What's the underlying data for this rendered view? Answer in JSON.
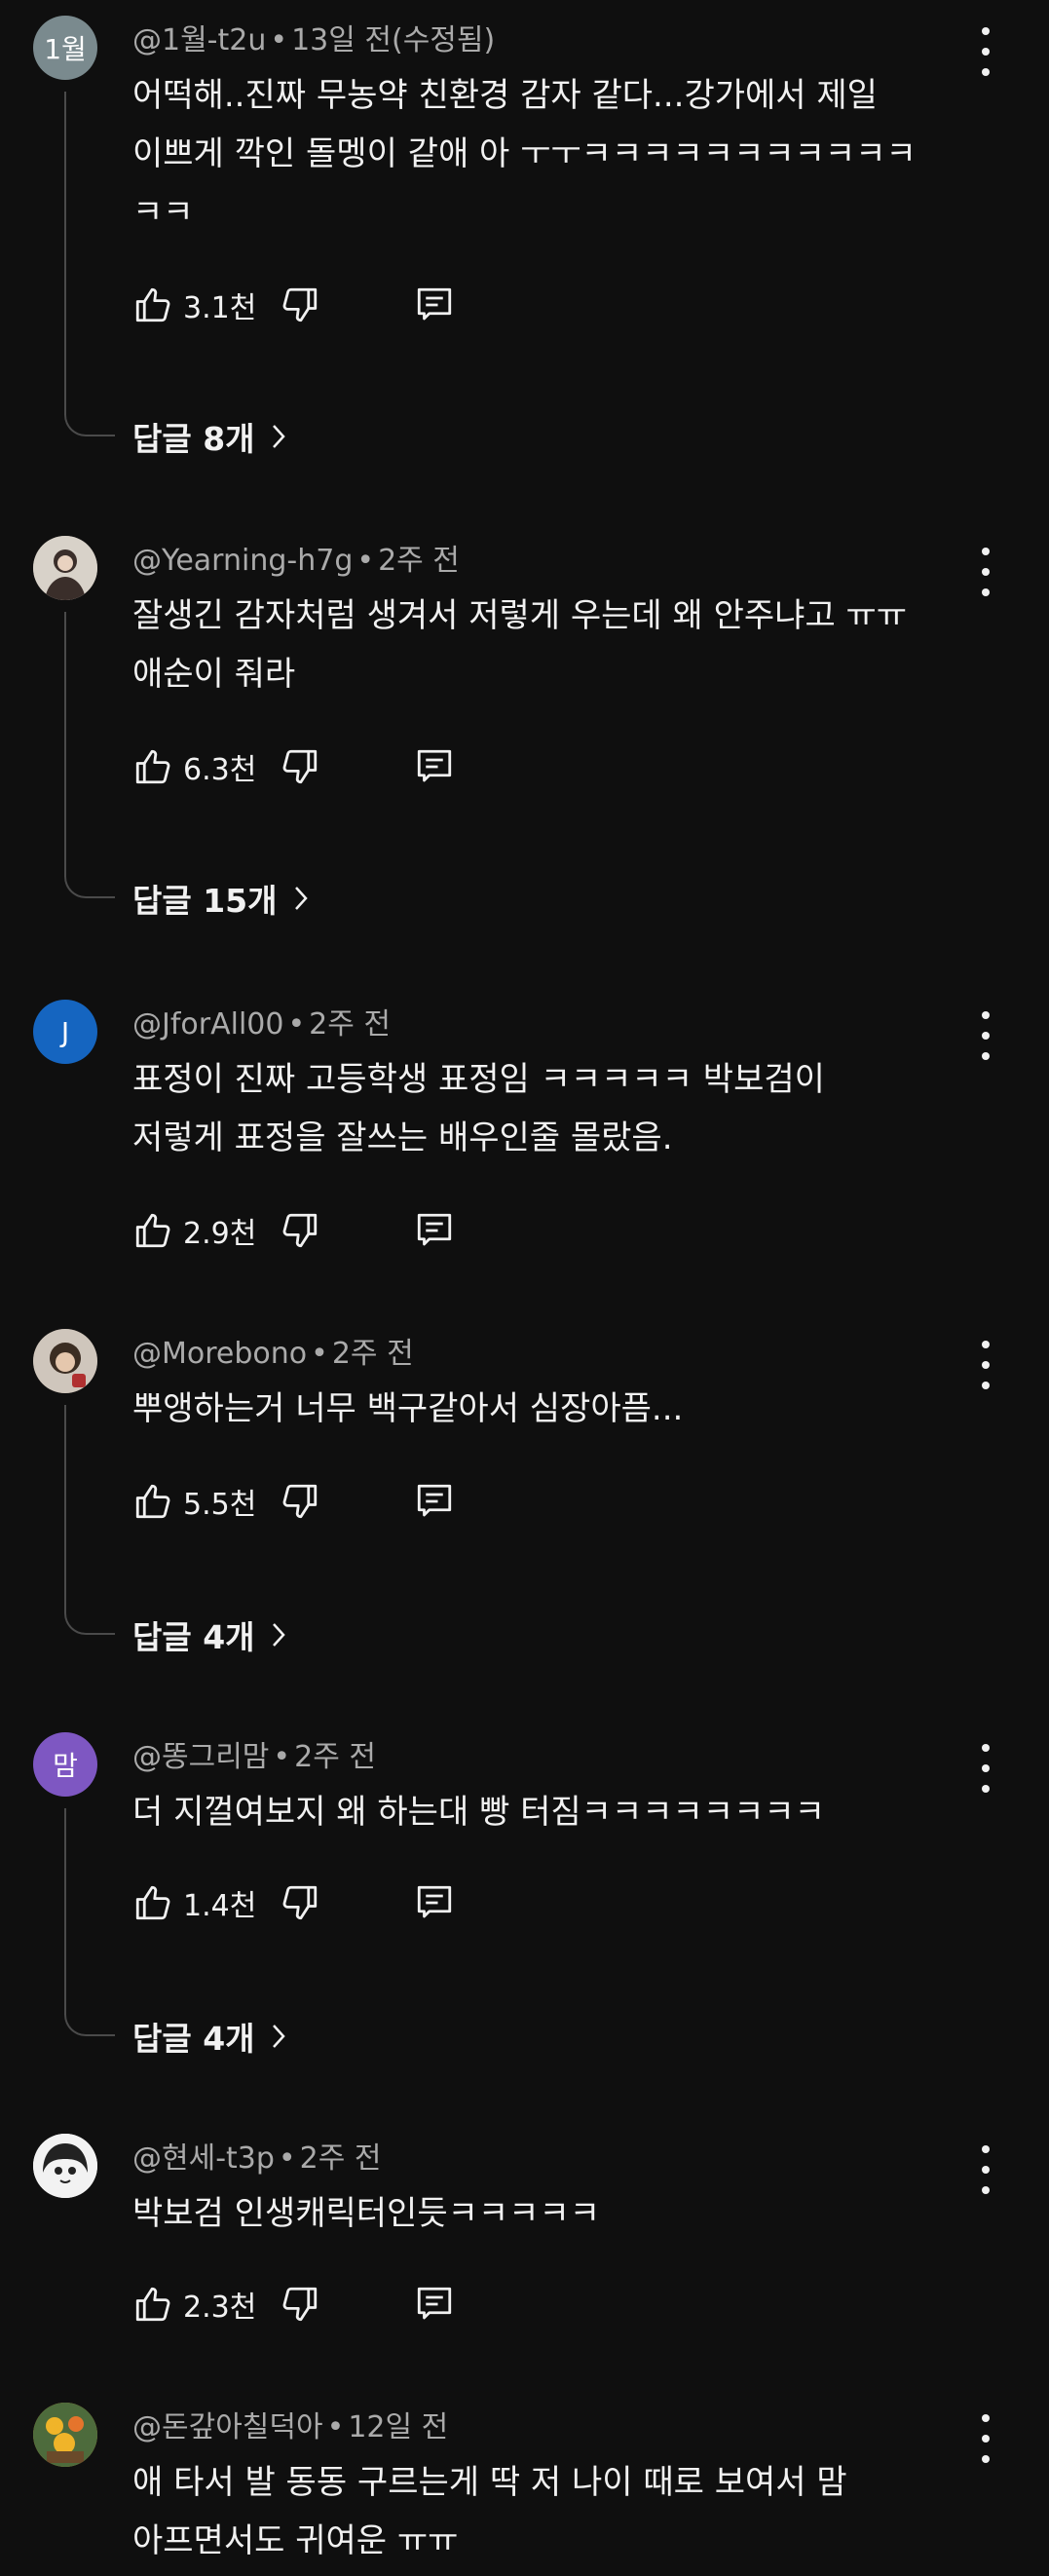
{
  "comments": [
    {
      "avatar_text": "1월",
      "avatar_color": "#7a8a8e",
      "author": "@1월-t2u",
      "time": "13일 전(수정됨)",
      "text_lines": [
        "어떡해..진짜 무농약 친환경 감자 같다...강가에서 제일",
        "이쁘게 깍인 돌멩이 같애 아 ㅜㅜㅋㅋㅋㅋㅋㅋㅋㅋㅋㅋㅋ",
        "ㅋㅋ"
      ],
      "likes": "3.1천",
      "replies": "답글 8개"
    },
    {
      "avatar_text": "",
      "avatar_color": "#8f7f76",
      "author": "@Yearning-h7g",
      "time": "2주 전",
      "text_lines": [
        "잘생긴 감자처럼 생겨서 저렇게 우는데 왜 안주냐고 ㅠㅠ",
        "애순이 줘라"
      ],
      "likes": "6.3천",
      "replies": "답글 15개"
    },
    {
      "avatar_text": "J",
      "avatar_color": "#1565c0",
      "author": "@JforAll00",
      "time": "2주 전",
      "text_lines": [
        "표정이 진짜 고등학생 표정임 ㅋㅋㅋㅋㅋ 박보검이",
        "저렇게 표정을 잘쓰는 배우인줄 몰랐음."
      ],
      "likes": "2.9천",
      "replies": ""
    },
    {
      "avatar_text": "",
      "avatar_color": "#5b4a3f",
      "author": "@Morebono",
      "time": "2주 전",
      "text_lines": [
        "뿌앵하는거 너무 백구같아서 심장아픔..."
      ],
      "likes": "5.5천",
      "replies": "답글 4개"
    },
    {
      "avatar_text": "맘",
      "avatar_color": "#7e57c2",
      "author": "@똥그리맘",
      "time": "2주 전",
      "text_lines": [
        "더 지껄여보지 왜 하는대 빵 터짐ㅋㅋㅋㅋㅋㅋㅋㅋ"
      ],
      "likes": "1.4천",
      "replies": "답글 4개"
    },
    {
      "avatar_text": "",
      "avatar_color": "#e8e8e8",
      "author": "@현세-t3p",
      "time": "2주 전",
      "text_lines": [
        "박보검 인생캐릭터인듯ㅋㅋㅋㅋㅋ"
      ],
      "likes": "2.3천",
      "replies": ""
    },
    {
      "avatar_text": "",
      "avatar_color": "#c98a2e",
      "author": "@돈갚아칠덕아",
      "time": "12일 전",
      "text_lines": [
        "애 타서 발 동동 구르는게 딱 저 나이 때로 보여서 맘",
        "아프면서도 귀여운 ㅠㅠ"
      ],
      "likes": "",
      "replies": ""
    }
  ]
}
